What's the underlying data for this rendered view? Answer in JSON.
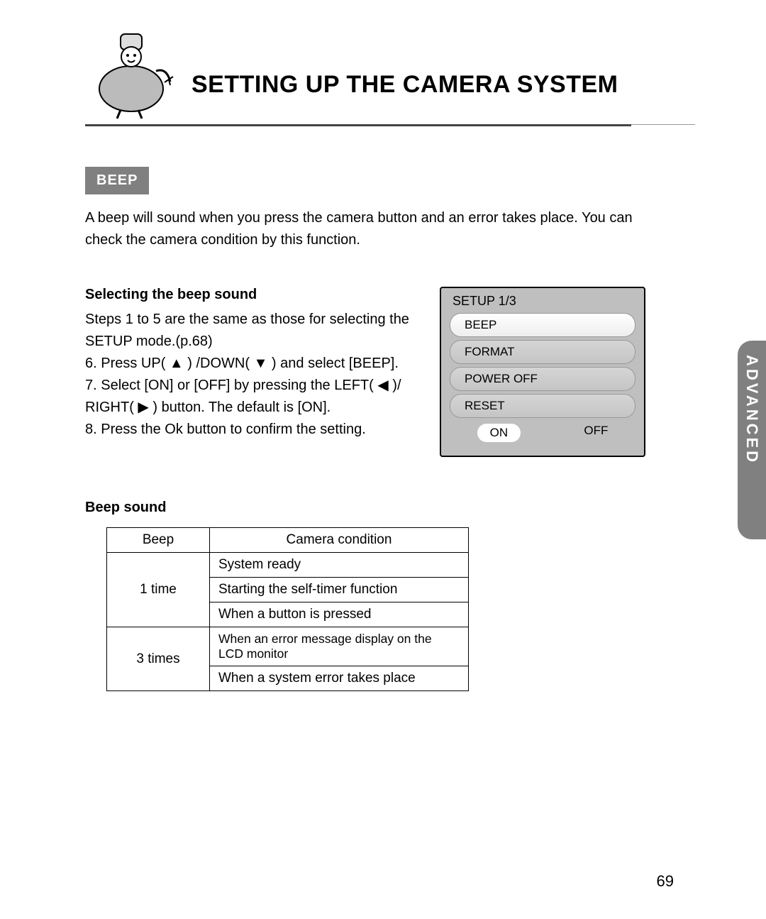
{
  "header": {
    "title": "SETTING UP THE CAMERA SYSTEM"
  },
  "badge": "BEEP",
  "intro": "A beep will sound when you press the camera button and an error takes place. You can check the camera condition by this function.",
  "select": {
    "heading": "Selecting the beep sound",
    "line1": "Steps 1 to 5 are the same as those for selecting the SETUP mode.(p.68)",
    "line2": "6. Press UP( ▲ ) /DOWN( ▼ ) and select [BEEP].",
    "line3": "7. Select [ON] or [OFF] by pressing the LEFT( ◀ )/ RIGHT( ▶ ) button. The default is [ON].",
    "line4": "8. Press the Ok button to confirm the setting."
  },
  "lcd": {
    "title": "SETUP 1/3",
    "items": [
      "BEEP",
      "FORMAT",
      "POWER OFF",
      "RESET"
    ],
    "onoff": {
      "on": "ON",
      "off": "OFF"
    }
  },
  "sidetab": "ADVANCED",
  "table": {
    "heading": "Beep sound",
    "h1": "Beep",
    "h2": "Camera condition",
    "r1c1": "1 time",
    "r1a": "System ready",
    "r1b": "Starting the self-timer function",
    "r1c": "When a button is pressed",
    "r2c1": "3 times",
    "r2a": "When an error message display on the LCD monitor",
    "r2b": "When a system error takes place"
  },
  "page_number": "69"
}
